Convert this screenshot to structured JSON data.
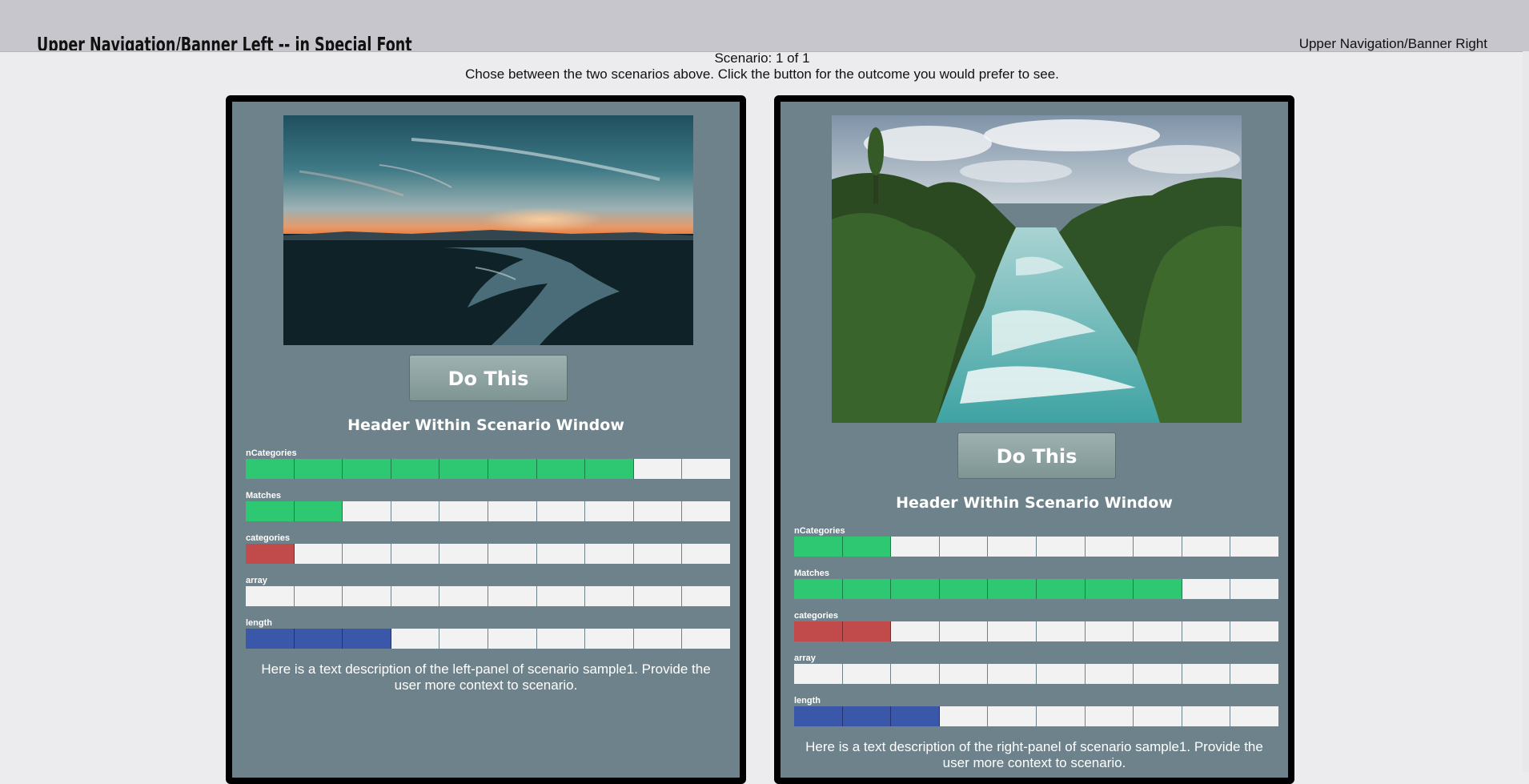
{
  "banner": {
    "left_text": "Upper Navigation/Banner Left -- in Special Font",
    "right_text": "Upper Navigation/Banner Right"
  },
  "scenario": {
    "counter": "Scenario: 1 of 1",
    "instructions": "Chose between the two scenarios above. Click the button for the outcome you would prefer to see."
  },
  "colors": {
    "green": "#2ec872",
    "red": "#c04b4a",
    "blue": "#3a57a9",
    "empty": "#f2f2f2",
    "panel": "#6d828a"
  },
  "panels": [
    {
      "image_icon": "sunset-lake-photo",
      "button_label": "Do This",
      "header": "Header Within Scenario Window",
      "description": "Here is a text description of the left-panel of scenario sample1. Provide the user more context to scenario.",
      "meters": [
        {
          "label": "nCategories",
          "filled": 8,
          "total": 10,
          "color": "green"
        },
        {
          "label": "Matches",
          "filled": 2,
          "total": 10,
          "color": "green"
        },
        {
          "label": "categories",
          "filled": 1,
          "total": 10,
          "color": "red"
        },
        {
          "label": "array",
          "filled": 0,
          "total": 10,
          "color": "green"
        },
        {
          "label": "length",
          "filled": 3,
          "total": 10,
          "color": "blue"
        }
      ]
    },
    {
      "image_icon": "river-rapids-photo",
      "button_label": "Do This",
      "header": "Header Within Scenario Window",
      "description": "Here is a text description of the right-panel of scenario sample1. Provide the user more context to scenario.",
      "meters": [
        {
          "label": "nCategories",
          "filled": 2,
          "total": 10,
          "color": "green"
        },
        {
          "label": "Matches",
          "filled": 8,
          "total": 10,
          "color": "green"
        },
        {
          "label": "categories",
          "filled": 2,
          "total": 10,
          "color": "red"
        },
        {
          "label": "array",
          "filled": 0,
          "total": 10,
          "color": "green"
        },
        {
          "label": "length",
          "filled": 3,
          "total": 10,
          "color": "blue"
        }
      ]
    }
  ]
}
